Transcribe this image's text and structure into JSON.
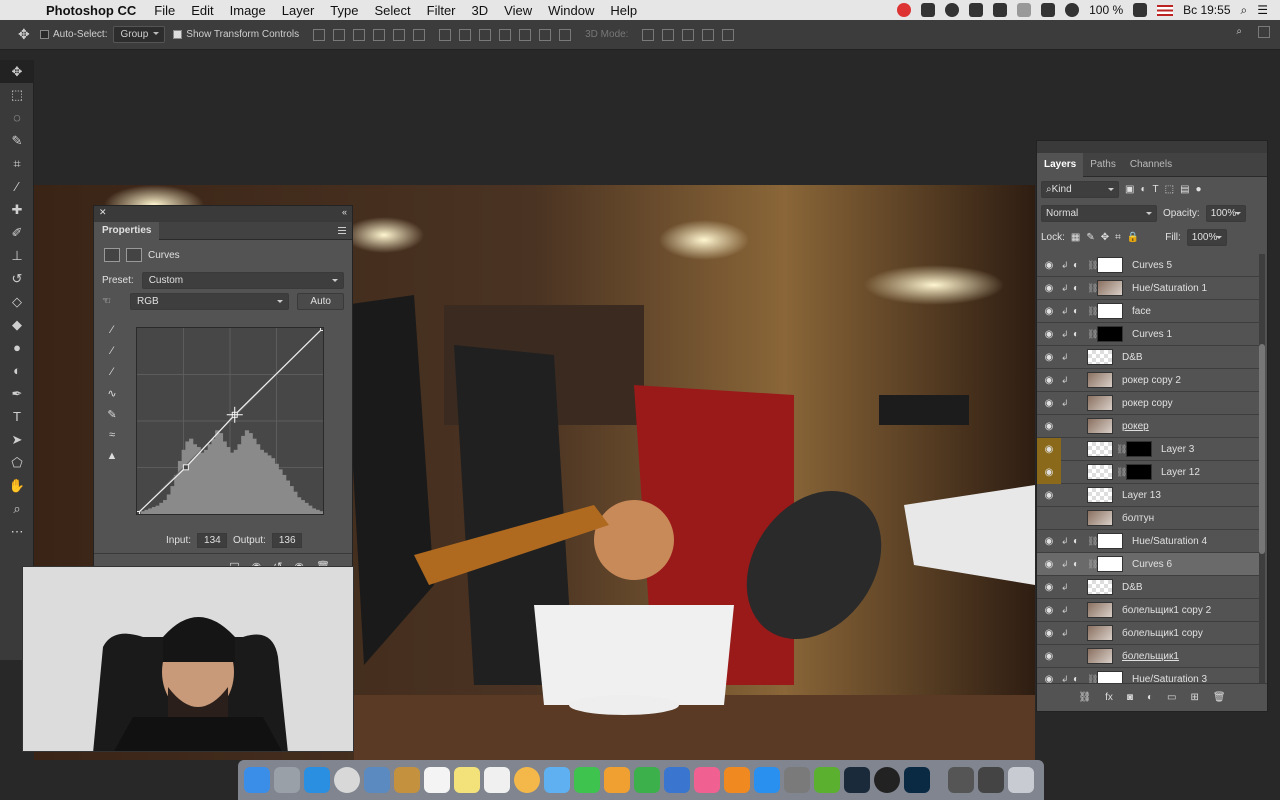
{
  "menubar": {
    "app_name": "Photoshop CC",
    "items": [
      "File",
      "Edit",
      "Image",
      "Layer",
      "Type",
      "Select",
      "Filter",
      "3D",
      "View",
      "Window",
      "Help"
    ],
    "battery": "100 %",
    "clock": "Вс 19:55"
  },
  "options": {
    "auto_select_label": "Auto-Select:",
    "auto_select_value": "Group",
    "transform_label": "Show Transform Controls",
    "mode_3d_label": "3D Mode:"
  },
  "properties": {
    "tab": "Properties",
    "title": "Curves",
    "preset_label": "Preset:",
    "preset_value": "Custom",
    "channel_value": "RGB",
    "auto_label": "Auto",
    "input_label": "Input:",
    "input_value": "134",
    "output_label": "Output:",
    "output_value": "136"
  },
  "curve": {
    "points": [
      [
        0,
        0
      ],
      [
        67,
        64
      ],
      [
        134,
        136
      ],
      [
        255,
        255
      ]
    ],
    "histogram": [
      0,
      2,
      3,
      4,
      5,
      6,
      8,
      10,
      14,
      20,
      28,
      38,
      46,
      52,
      54,
      50,
      48,
      44,
      46,
      50,
      54,
      60,
      58,
      52,
      48,
      44,
      46,
      50,
      56,
      60,
      58,
      54,
      50,
      46,
      44,
      42,
      40,
      36,
      32,
      28,
      24,
      20,
      16,
      12,
      10,
      8,
      6,
      4,
      3,
      2
    ]
  },
  "layers": {
    "tabs": [
      "Layers",
      "Paths",
      "Channels"
    ],
    "kind_label": "Kind",
    "blend_mode": "Normal",
    "opacity_label": "Opacity:",
    "opacity_value": "100%",
    "lock_label": "Lock:",
    "fill_label": "Fill:",
    "fill_value": "100%",
    "rows": [
      {
        "name": "Curves 5",
        "visible": true,
        "clip": true,
        "adj": true,
        "thumb": "white"
      },
      {
        "name": "Hue/Saturation 1",
        "visible": true,
        "clip": true,
        "adj": true,
        "thumb": "photo"
      },
      {
        "name": "face",
        "visible": true,
        "clip": true,
        "adj": true,
        "thumb": "white"
      },
      {
        "name": "Curves 1",
        "visible": true,
        "clip": true,
        "adj": true,
        "thumb": "black"
      },
      {
        "name": "D&B",
        "visible": true,
        "clip": true,
        "adj": false,
        "thumb": "checker"
      },
      {
        "name": "рокер copy 2",
        "visible": true,
        "clip": true,
        "adj": false,
        "thumb": "photo"
      },
      {
        "name": "рокер copy",
        "visible": true,
        "clip": true,
        "adj": false,
        "thumb": "photo"
      },
      {
        "name": "рокер",
        "visible": true,
        "clip": false,
        "adj": false,
        "thumb": "photo",
        "underline": true
      },
      {
        "name": "Layer 3",
        "visible": true,
        "clip": false,
        "adj": false,
        "thumb": "checker",
        "mask": "black",
        "golden": true
      },
      {
        "name": "Layer 12",
        "visible": true,
        "clip": false,
        "adj": false,
        "thumb": "checker",
        "mask": "black",
        "golden": true
      },
      {
        "name": "Layer 13",
        "visible": true,
        "clip": false,
        "adj": false,
        "thumb": "checker"
      },
      {
        "name": "болтун",
        "visible": false,
        "clip": false,
        "adj": false,
        "thumb": "photo"
      },
      {
        "name": "Hue/Saturation 4",
        "visible": true,
        "clip": true,
        "adj": true,
        "thumb": "white"
      },
      {
        "name": "Curves 6",
        "visible": true,
        "clip": true,
        "adj": true,
        "thumb": "white",
        "selected": true
      },
      {
        "name": "D&B",
        "visible": true,
        "clip": true,
        "adj": false,
        "thumb": "checker"
      },
      {
        "name": "болельщик1 copy 2",
        "visible": true,
        "clip": true,
        "adj": false,
        "thumb": "photo"
      },
      {
        "name": "болельщик1 copy",
        "visible": true,
        "clip": true,
        "adj": false,
        "thumb": "photo"
      },
      {
        "name": "болельщик1",
        "visible": true,
        "clip": false,
        "adj": false,
        "thumb": "photo",
        "underline": true
      },
      {
        "name": "Hue/Saturation 3",
        "visible": true,
        "clip": true,
        "adj": true,
        "thumb": "white"
      }
    ]
  },
  "colors": {
    "panel": "#535353",
    "selected_row": "#6a6a6a",
    "golden": "#8a6a1a"
  }
}
